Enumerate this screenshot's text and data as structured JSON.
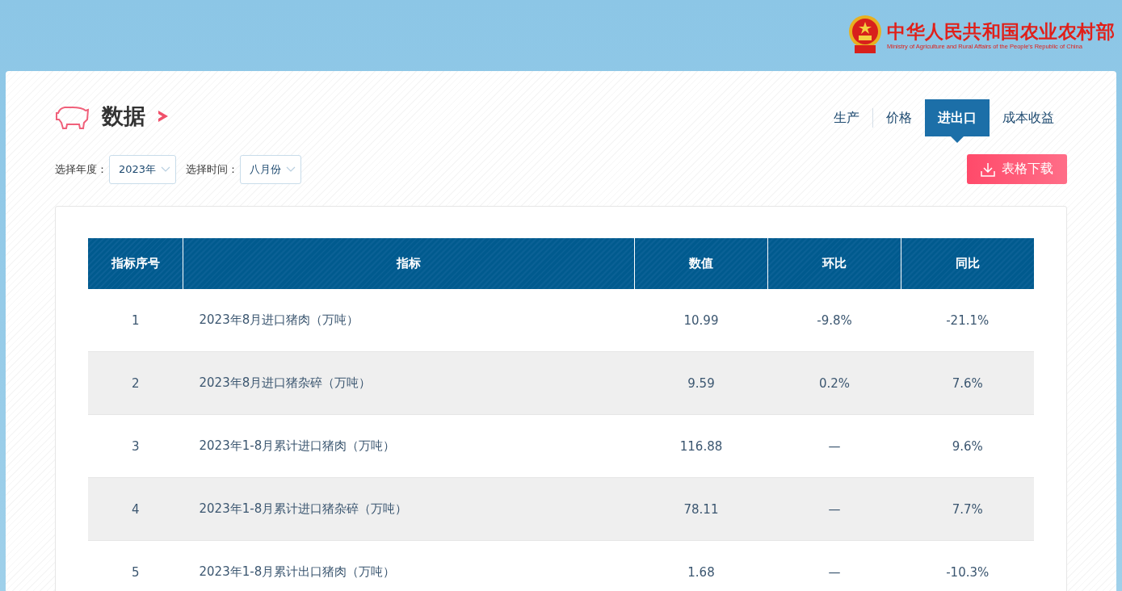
{
  "header": {
    "logo_title": "中华人民共和国农业农村部",
    "logo_subtitle": "Ministry of Agriculture and Rural Affairs of the People's Republic of China"
  },
  "page_title": "数据",
  "tabs": [
    {
      "label": "生产",
      "selected": false
    },
    {
      "label": "价格",
      "selected": false
    },
    {
      "label": "进出口",
      "selected": true
    },
    {
      "label": "成本收益",
      "selected": false
    }
  ],
  "filters": [
    {
      "label": "选择年度：",
      "value": "2023年"
    },
    {
      "label": "选择时间：",
      "value": "八月份"
    }
  ],
  "download_button": "表格下载",
  "table": {
    "columns": [
      "指标序号",
      "指标",
      "数值",
      "环比",
      "同比"
    ],
    "rows": [
      [
        "1",
        "2023年8月进口猪肉（万吨）",
        "10.99",
        "-9.8%",
        "-21.1%"
      ],
      [
        "2",
        "2023年8月进口猪杂碎（万吨）",
        "9.59",
        "0.2%",
        "7.6%"
      ],
      [
        "3",
        "2023年1-8月累计进口猪肉（万吨）",
        "116.88",
        "—",
        "9.6%"
      ],
      [
        "4",
        "2023年1-8月累计进口猪杂碎（万吨）",
        "78.11",
        "—",
        "7.7%"
      ],
      [
        "5",
        "2023年1-8月累计出口猪肉（万吨）",
        "1.68",
        "—",
        "-10.3%"
      ]
    ]
  }
}
